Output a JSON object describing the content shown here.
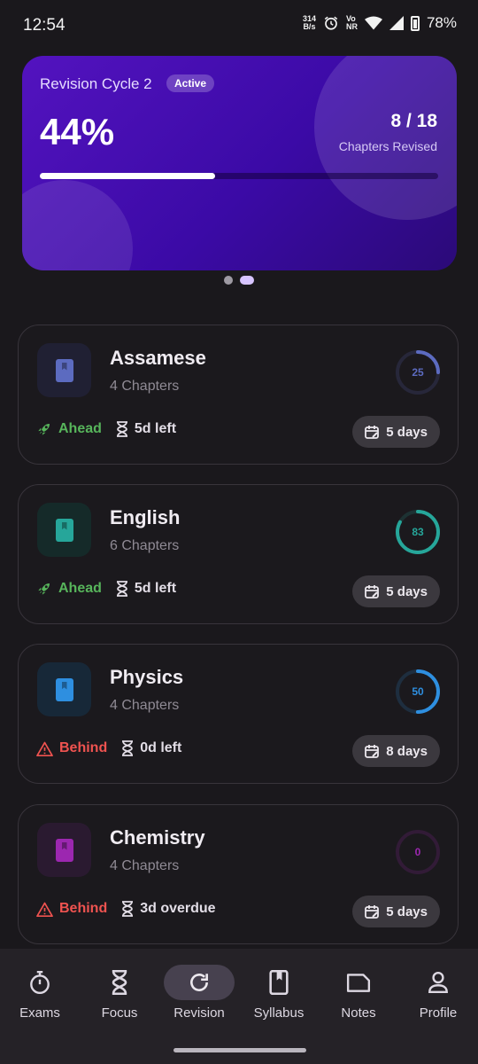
{
  "status_bar": {
    "time": "12:54",
    "net_speed_top": "314",
    "net_speed_bottom": "B/s",
    "volte_top": "Vo",
    "volte_bottom": "NR",
    "battery": "78%"
  },
  "hero": {
    "cycle_label": "Revision Cycle 2",
    "badge": "Active",
    "percent_text": "44%",
    "progress_fraction": 0.44,
    "count_text": "8 / 18",
    "count_label": "Chapters Revised",
    "gradient_colors": [
      "#5313bf",
      "#2b0a78"
    ]
  },
  "carousel": {
    "pages": 2,
    "active_index": 1
  },
  "subjects": [
    {
      "name": "Assamese",
      "chapters": "4 Chapters",
      "progress": 25,
      "progress_text": "25",
      "color": "#5c6bc0",
      "icon_bg": "#202033",
      "status": "Ahead",
      "status_icon": "rocket-icon",
      "time_left": "5d left",
      "days": "5 days"
    },
    {
      "name": "English",
      "chapters": "6 Chapters",
      "progress": 83,
      "progress_text": "83",
      "color": "#26a69a",
      "icon_bg": "#152a29",
      "status": "Ahead",
      "status_icon": "rocket-icon",
      "time_left": "5d left",
      "days": "5 days"
    },
    {
      "name": "Physics",
      "chapters": "4 Chapters",
      "progress": 50,
      "progress_text": "50",
      "color": "#2e8fe0",
      "icon_bg": "#172838",
      "status": "Behind",
      "status_icon": "warning-icon",
      "time_left": "0d left",
      "days": "8 days"
    },
    {
      "name": "Chemistry",
      "chapters": "4 Chapters",
      "progress": 0,
      "progress_text": "0",
      "color": "#9c27b0",
      "icon_bg": "#2a1a30",
      "status": "Behind",
      "status_icon": "warning-icon",
      "time_left": "3d overdue",
      "days": "5 days"
    }
  ],
  "nav": {
    "items": [
      {
        "label": "Exams",
        "icon": "stopwatch-icon"
      },
      {
        "label": "Focus",
        "icon": "hourglass-icon"
      },
      {
        "label": "Revision",
        "icon": "refresh-icon"
      },
      {
        "label": "Syllabus",
        "icon": "book-icon"
      },
      {
        "label": "Notes",
        "icon": "note-icon"
      },
      {
        "label": "Profile",
        "icon": "person-icon"
      }
    ],
    "active": "Revision"
  }
}
